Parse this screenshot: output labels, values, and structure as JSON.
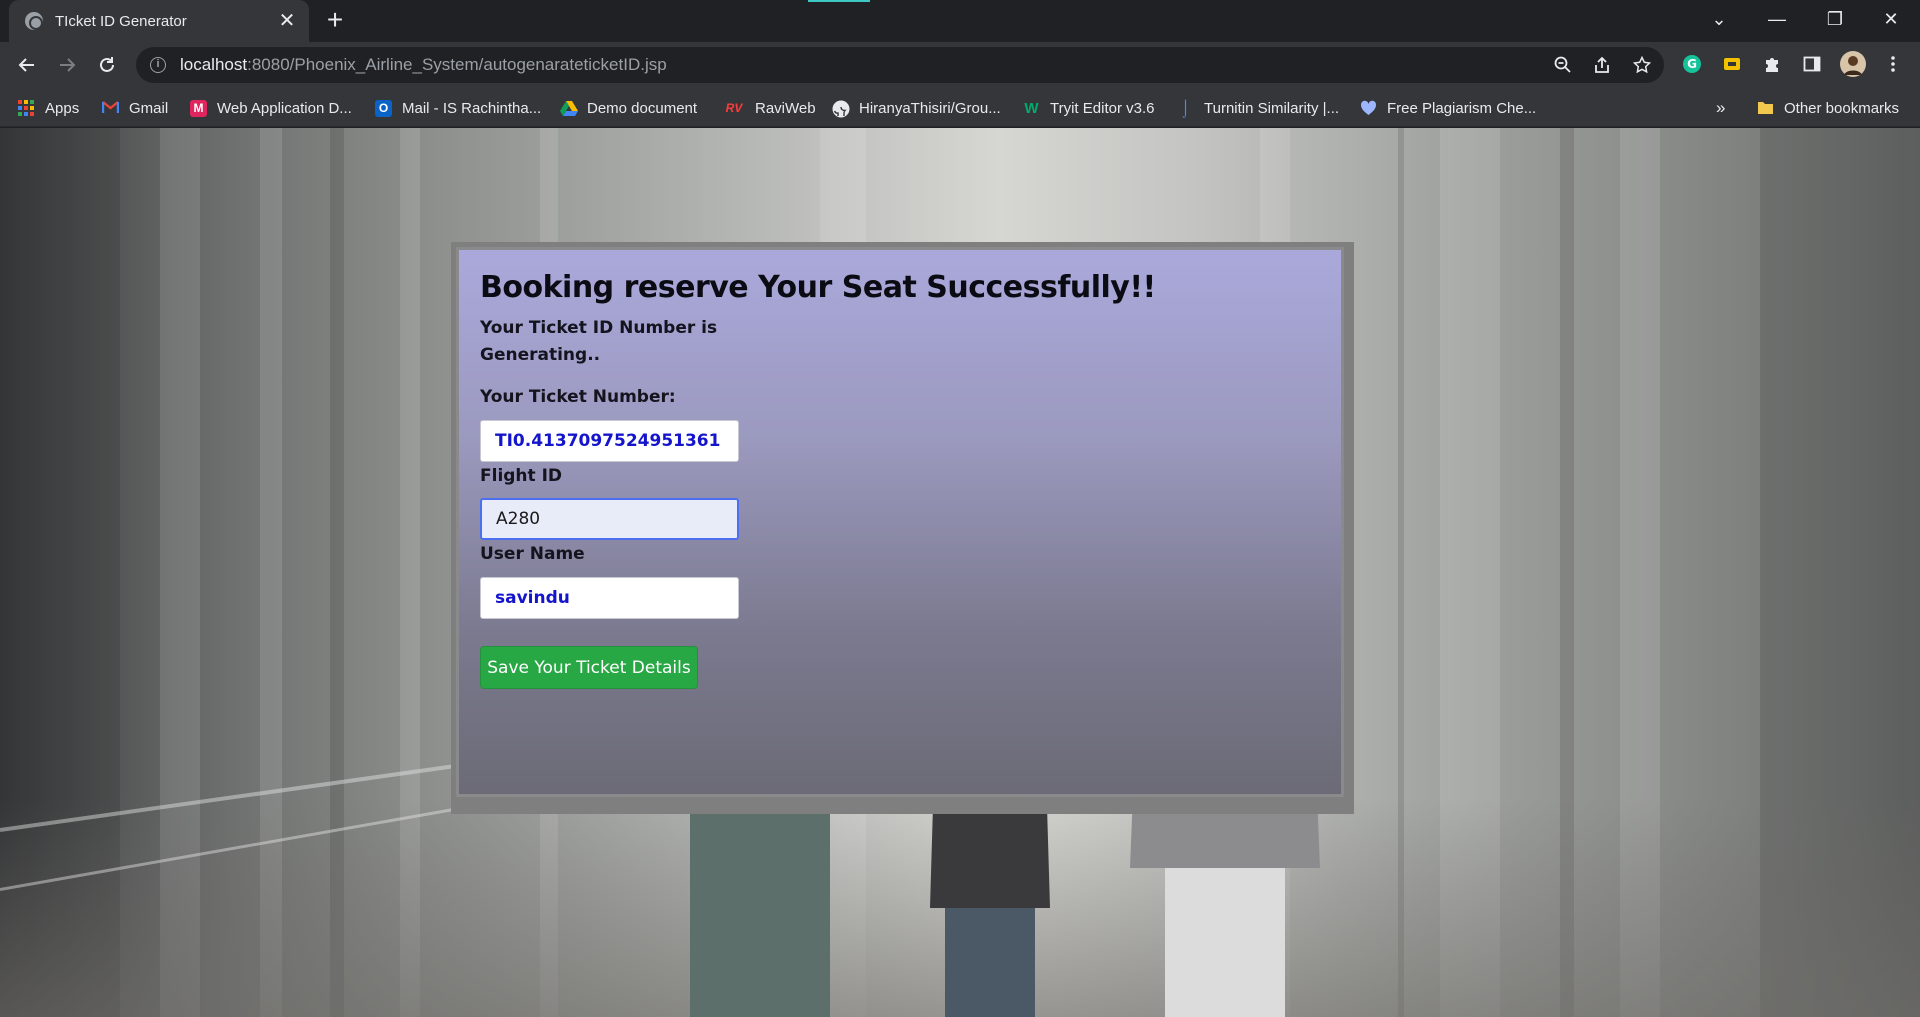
{
  "browser": {
    "tab_title": "TIcket ID Generator",
    "tab_close": "✕",
    "new_tab": "+",
    "url_host": "localhost",
    "url_path": ":8080/Phoenix_Airline_System/autogenarateticketID.jsp",
    "window_controls": {
      "minimize": "—",
      "restore": "❐",
      "close": "✕",
      "search_tabs": "⌄"
    },
    "bookmarks": [
      {
        "label": "Apps",
        "icon": "apps-icon"
      },
      {
        "label": "Gmail",
        "icon": "gmail-icon"
      },
      {
        "label": "Web Application D...",
        "icon": "m-icon"
      },
      {
        "label": "Mail - IS Rachintha...",
        "icon": "outlook-icon"
      },
      {
        "label": "Demo document",
        "icon": "drive-icon"
      },
      {
        "label": "RaviWeb",
        "icon": "rv-icon"
      },
      {
        "label": "HiranyaThisiri/Grou...",
        "icon": "github-icon"
      },
      {
        "label": "Tryit Editor v3.6",
        "icon": "w3-icon"
      },
      {
        "label": "Turnitin Similarity |...",
        "icon": "turnitin-icon"
      },
      {
        "label": "Free Plagiarism Che...",
        "icon": "plagiarism-icon"
      }
    ],
    "bookmarks_overflow": "»",
    "other_bookmarks": "Other bookmarks",
    "colors": {
      "frame": "#202124",
      "toolbar": "#35363a",
      "text": "#e8eaed"
    }
  },
  "page": {
    "heading": "Booking reserve Your Seat Successfully!!",
    "generating_message": "Your Ticket ID Number is Generating..",
    "ticket_label": "Your Ticket Number:",
    "ticket_value": "TI0.4137097524951361",
    "flight_label": "Flight ID",
    "flight_value": "A280",
    "username_label": "User Name",
    "username_value": "savindu",
    "save_button": "Save Your Ticket Details",
    "colors": {
      "button": "#28a745",
      "input_text": "#1414cc"
    }
  }
}
